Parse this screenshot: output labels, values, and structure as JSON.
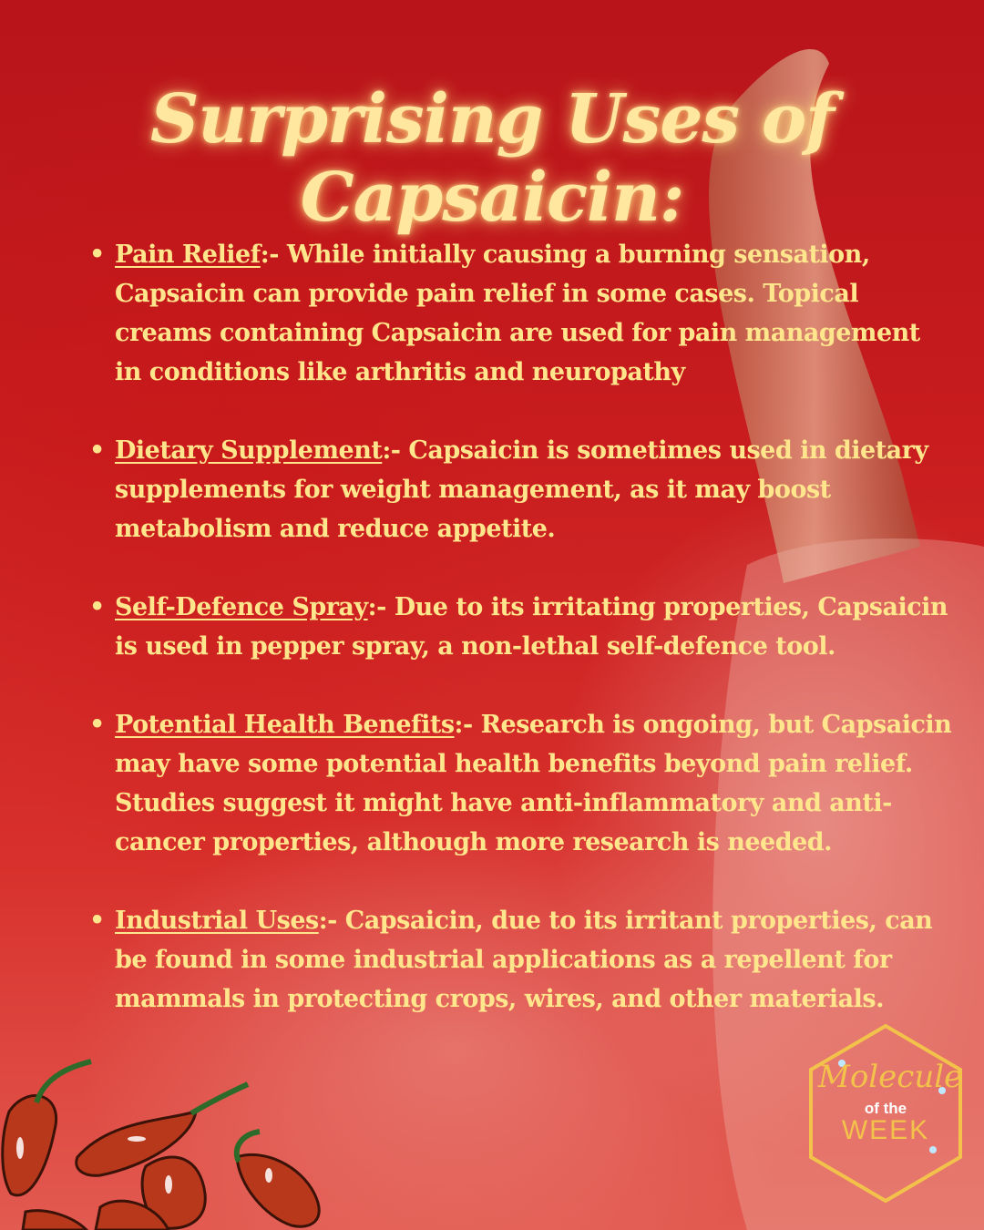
{
  "title": "Surprising Uses of Capsaicin:",
  "uses": [
    {
      "term": "Pain Relief",
      "text": ":- While initially causing a burning sensation, Capsaicin can provide pain relief in some cases. Topical creams containing Capsaicin are used for pain management in conditions like arthritis and neuropathy"
    },
    {
      "term": "Dietary Supplement",
      "text": ":- Capsaicin is sometimes used in dietary supplements for weight management, as it may boost metabolism and reduce appetite."
    },
    {
      "term": "Self-Defence Spray",
      "text": ":- Due to its irritating properties, Capsaicin is used in pepper spray, a non-lethal self-defence tool."
    },
    {
      "term": "Potential Health Benefits",
      "text": ":- Research is ongoing, but Capsaicin may have some potential health benefits beyond pain relief. Studies suggest it might have anti-inflammatory and anti-cancer properties, although more research is needed."
    },
    {
      "term": "Industrial Uses",
      "text": ":- Capsaicin, due to its irritant properties, can be found in some industrial applications as a repellent for mammals in protecting crops, wires, and other materials."
    }
  ],
  "logo": {
    "line1": "Molecule",
    "line2": "of the",
    "line3": "WEEK"
  },
  "colors": {
    "text": "#ffe68c",
    "title": "#ffe7a0",
    "background": "#c81c1e",
    "logo_gold": "#f3c24a"
  },
  "icons": [
    "chili-pepper-icon"
  ]
}
